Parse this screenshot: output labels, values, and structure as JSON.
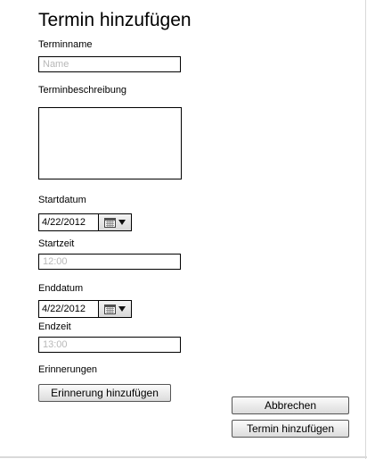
{
  "page": {
    "title": "Termin hinzufügen"
  },
  "form": {
    "name": {
      "label": "Terminname",
      "value": "",
      "placeholder": "Name"
    },
    "description": {
      "label": "Terminbeschreibung",
      "value": ""
    },
    "start_date": {
      "label": "Startdatum",
      "value": "4/22/2012",
      "icon": "calendar-icon"
    },
    "start_time": {
      "label": "Startzeit",
      "value": "",
      "placeholder": "12:00"
    },
    "end_date": {
      "label": "Enddatum",
      "value": "4/22/2012",
      "icon": "calendar-icon"
    },
    "end_time": {
      "label": "Endzeit",
      "value": "",
      "placeholder": "13:00"
    },
    "reminders": {
      "label": "Erinnerungen",
      "add_button_label": "Erinnerung hinzufügen"
    }
  },
  "actions": {
    "cancel_label": "Abbrechen",
    "submit_label": "Termin hinzufügen"
  }
}
